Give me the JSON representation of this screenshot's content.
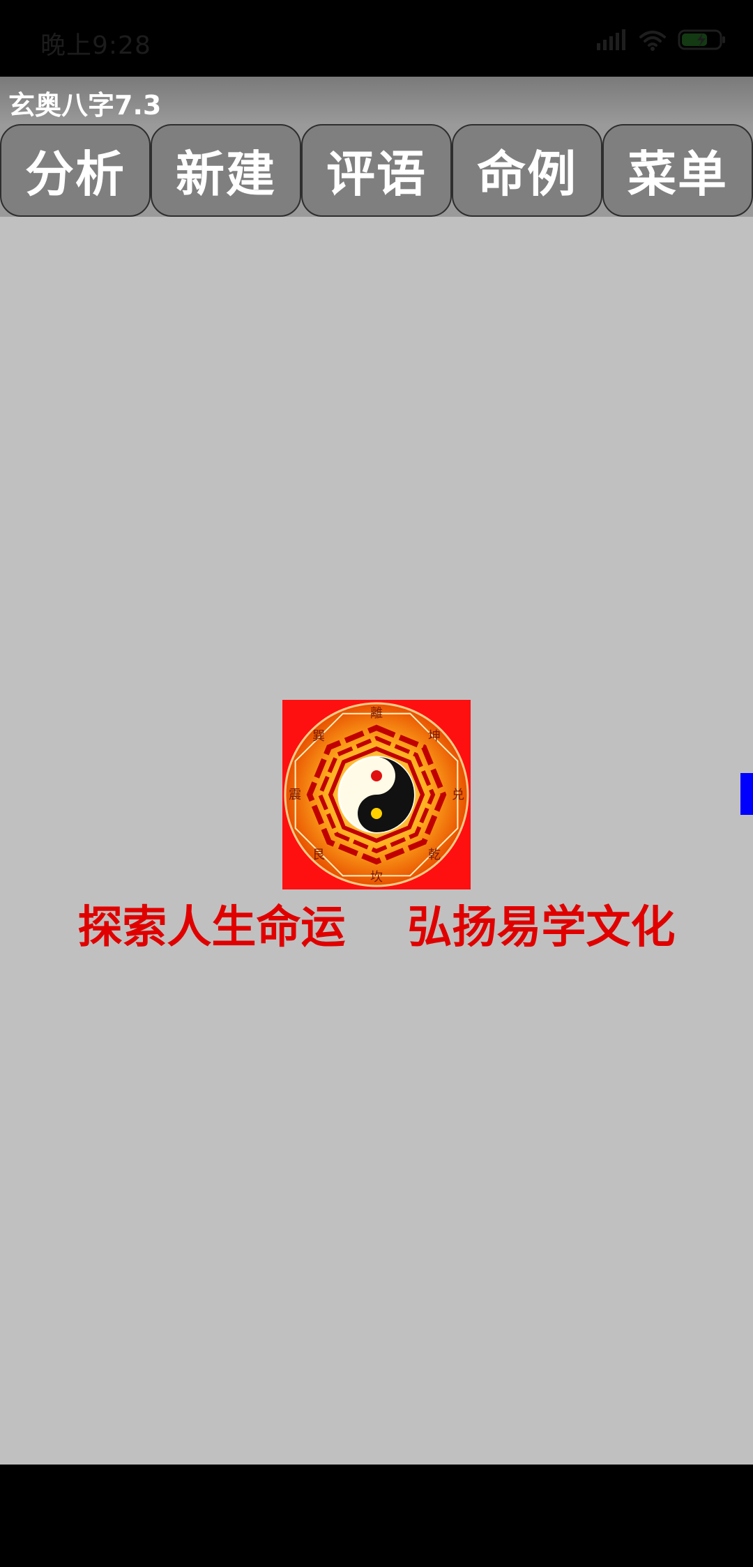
{
  "status_bar": {
    "time": "晚上9:28",
    "icons": [
      "signal-icon",
      "wifi-icon",
      "battery-charging-icon"
    ]
  },
  "app": {
    "title": "玄奥八字7.3"
  },
  "toolbar": {
    "buttons": [
      {
        "label": "分析"
      },
      {
        "label": "新建"
      },
      {
        "label": "评语"
      },
      {
        "label": "命例"
      },
      {
        "label": "菜单"
      }
    ]
  },
  "main": {
    "logo_trigrams": [
      "離",
      "坤",
      "兑",
      "乾",
      "坎",
      "艮",
      "震",
      "巽"
    ],
    "slogan": "探索人生命运    弘扬易学文化"
  },
  "colors": {
    "content_bg": "#c0c0c0",
    "button_bg": "#7f7f7f",
    "slogan": "#e00000",
    "side_tab": "#0000ff"
  }
}
